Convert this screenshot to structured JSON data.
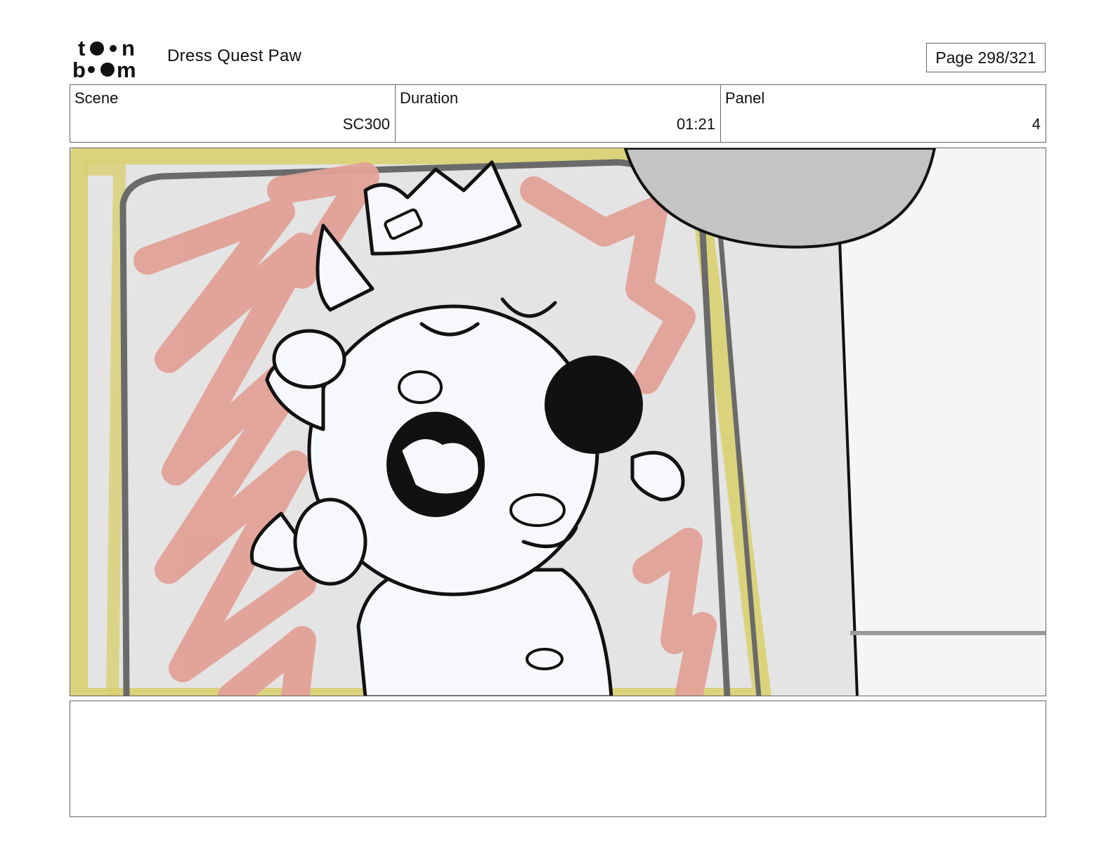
{
  "header": {
    "logo_text": "toon boom",
    "project_title": "Dress Quest Paw",
    "page_label": "Page 298/321"
  },
  "info": {
    "scene_label": "Scene",
    "scene_value": "SC300",
    "duration_label": "Duration",
    "duration_value": "01:21",
    "panel_label": "Panel",
    "panel_value": "4"
  },
  "notes": {
    "text": ""
  },
  "colors": {
    "border": "#666666",
    "frame_yellow": "#d8d070",
    "scribble_red": "#e2a197",
    "wall_gray": "#e2e2e2",
    "lamp_gray": "#c4c4c4",
    "character_fill": "#f7f8fb"
  }
}
